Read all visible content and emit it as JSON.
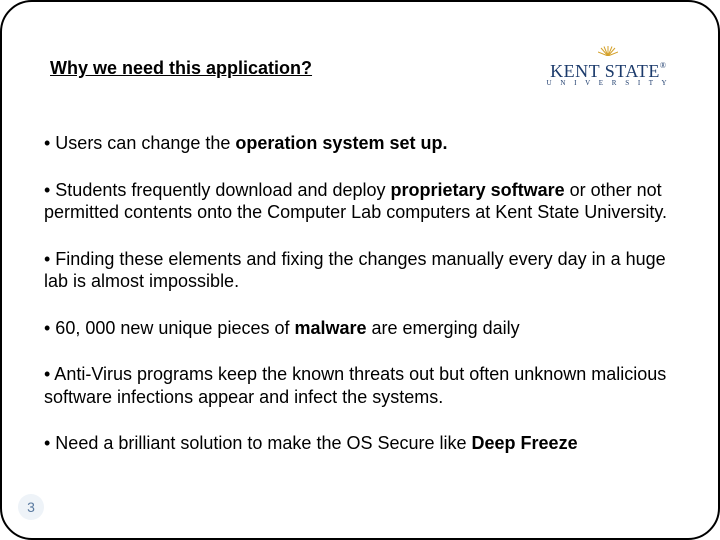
{
  "title": "Why we need this application?",
  "logo": {
    "main": "KENT STATE",
    "sub": "U N I V E R S I T Y"
  },
  "bullets": [
    {
      "pre": "• Users can change the ",
      "bold": "operation system set up.",
      "post": ""
    },
    {
      "pre": "• Students frequently download and deploy ",
      "bold": "proprietary software",
      "post": " or  other not permitted contents onto the Computer Lab computers at Kent State University."
    },
    {
      "pre": "• Finding these elements and fixing the changes manually every day in a huge lab is almost impossible.",
      "bold": "",
      "post": ""
    },
    {
      "pre": "• 60, 000 new unique pieces of ",
      "bold": "malware",
      "post": " are emerging daily"
    },
    {
      "pre": "• Anti-Virus programs keep the known threats out but often unknown malicious software infections appear and infect the systems.",
      "bold": "",
      "post": ""
    },
    {
      "pre": "• Need a brilliant solution to make the OS Secure like  ",
      "bold": "Deep Freeze",
      "post": ""
    }
  ],
  "page_number": "3"
}
